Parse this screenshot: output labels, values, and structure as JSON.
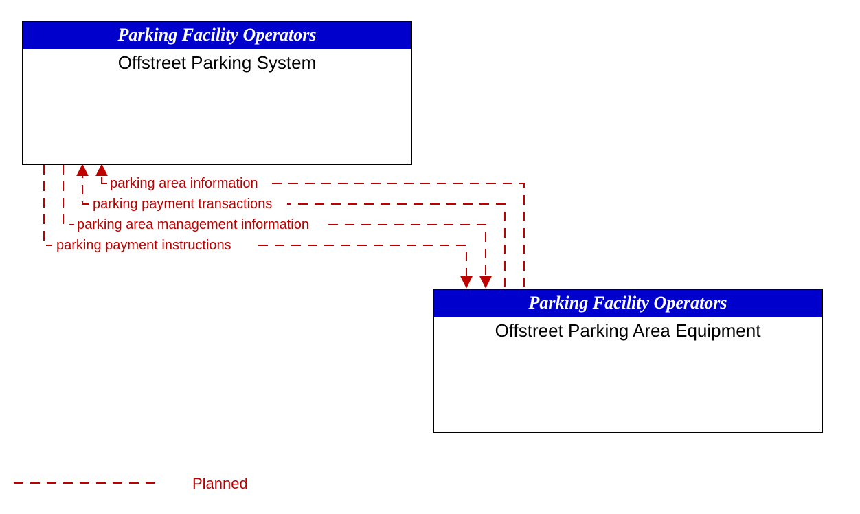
{
  "entities": {
    "top": {
      "header": "Parking Facility Operators",
      "title": "Offstreet Parking System"
    },
    "bottom": {
      "header": "Parking Facility Operators",
      "title": "Offstreet Parking Area Equipment"
    }
  },
  "flows": {
    "f1": "parking area information",
    "f2": "parking payment transactions",
    "f3": "parking area management information",
    "f4": "parking payment instructions"
  },
  "legend": {
    "planned": "Planned"
  },
  "colors": {
    "headerBg": "#0000cc",
    "flowLine": "#bd0000"
  }
}
